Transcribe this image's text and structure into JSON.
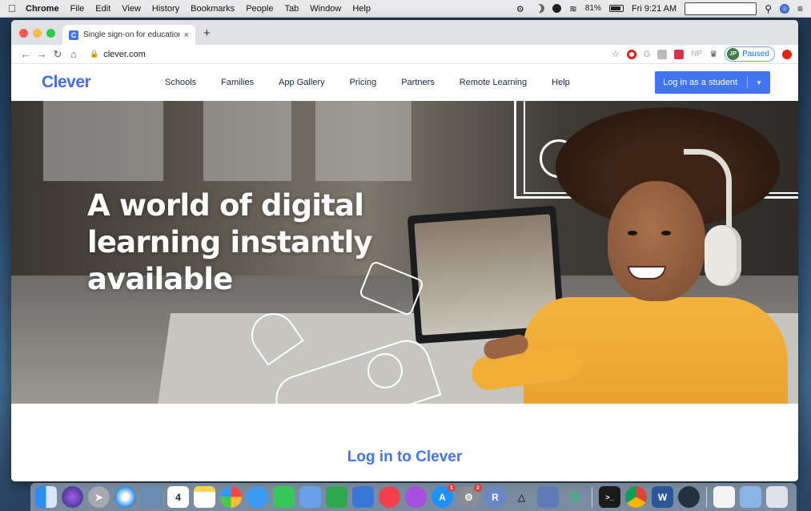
{
  "menubar": {
    "app_name": "Chrome",
    "items": [
      "File",
      "Edit",
      "View",
      "History",
      "Bookmarks",
      "People",
      "Tab",
      "Window",
      "Help"
    ],
    "battery": "81%",
    "clock": "Fri 9:21 AM"
  },
  "browser": {
    "tab": {
      "title": "Single sign-on for education | C",
      "favicon_letter": "C",
      "close": "×"
    },
    "new_tab": "+",
    "url": "clever.com",
    "profile": {
      "initials": "JP",
      "status": "Paused"
    },
    "extensions": [
      "opera-icon",
      "google-icon",
      "gray-extension-icon",
      "red-extension-icon",
      "np-extension",
      "puzzle-icon"
    ],
    "ext_labels": {
      "g": "G",
      "np": "NP"
    }
  },
  "site": {
    "logo": "Clever",
    "nav": [
      "Schools",
      "Families",
      "App Gallery",
      "Pricing",
      "Partners",
      "Remote Learning",
      "Help"
    ],
    "login_button": "Log in as a student",
    "hero_title": "A world of digital learning instantly available",
    "login_heading": "Log in to Clever"
  },
  "dock": {
    "calendar_day": "4",
    "badges": {
      "app_store": "1",
      "system_prefs": "2"
    },
    "r_label": "R",
    "word_label": "W"
  },
  "colors": {
    "brand_blue": "#4274f6",
    "nav_text": "#1b2746",
    "sweater": "#f0ae37"
  }
}
